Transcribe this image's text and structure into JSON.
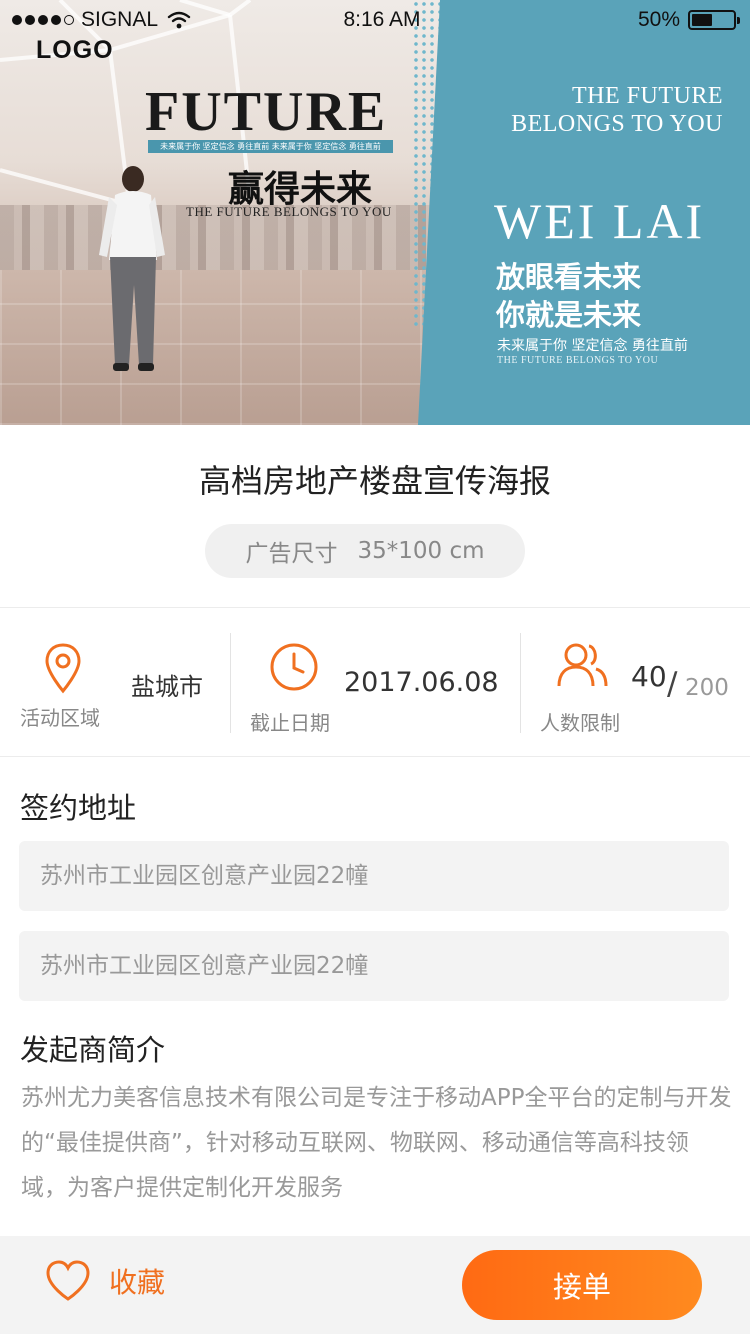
{
  "status_bar": {
    "signal_label": "SIGNAL",
    "signal_strength": 4,
    "time": "8:16 AM",
    "battery_percent": "50%",
    "battery_level": 0.5
  },
  "banner": {
    "logo": "LOGO",
    "headline_en": "FUTURE",
    "headline_bar": "未来属于你  坚定信念  勇往直前  未来属于你  坚定信念  勇往直前",
    "headline_cn": "赢得未来",
    "headline_sub_en": "THE FUTURE BELONGS TO YOU",
    "right_en_line1": "THE FUTURE",
    "right_en_line2": "BELONGS TO YOU",
    "right_big": "WEI LAI",
    "right_cn_line1": "放眼看未来",
    "right_cn_line2": "你就是未来",
    "right_slogan": "未来属于你  坚定信念  勇往直前",
    "right_slogan_en": "THE FUTURE BELONGS TO YOU"
  },
  "detail": {
    "title": "高档房地产楼盘宣传海报",
    "size_label": "广告尺寸",
    "size_value": "35*100 cm"
  },
  "info": {
    "area_label": "活动区域",
    "area_value": "盐城市",
    "deadline_label": "截止日期",
    "deadline_value": "2017.06.08",
    "people_label": "人数限制",
    "people_current": "40",
    "people_sep": "/",
    "people_max": "200",
    "accent_color": "#f07020"
  },
  "address": {
    "title": "签约地址",
    "line1": "苏州市工业园区创意产业园22幢",
    "line2": "苏州市工业园区创意产业园22幢"
  },
  "sponsor": {
    "title": "发起商简介",
    "text": "苏州尤力美客信息技术有限公司是专注于移动APP全平台的定制与开发的“最佳提供商”，针对移动互联网、物联网、移动通信等高科技领域，为客户提供定制化开发服务"
  },
  "bottom": {
    "favorite_label": "收藏",
    "accept_label": "接单",
    "button_color": "#ff7618"
  }
}
